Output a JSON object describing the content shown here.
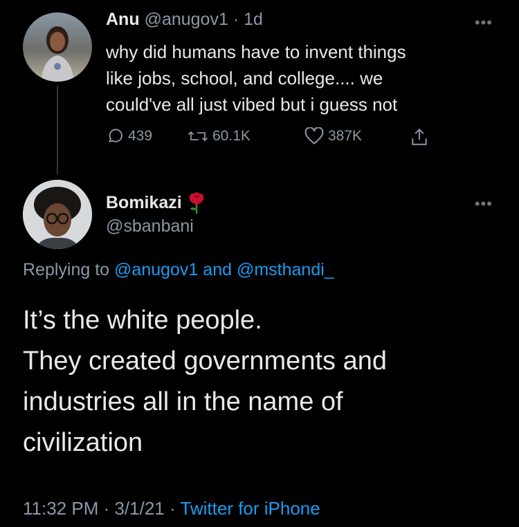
{
  "tweet": {
    "author_name": "Anu",
    "author_handle": "@anugov1",
    "separator": "·",
    "age": "1d",
    "text_lines": [
      "why did humans have to invent things",
      "like jobs, school, and college.... we",
      "could've all just vibed but i guess not"
    ],
    "stats": {
      "replies": "439",
      "retweets": "60.1K",
      "likes": "387K"
    }
  },
  "reply": {
    "author_name": "Bomikazi",
    "author_handle": "@sbanbani",
    "replying_prefix": "Replying to ",
    "replying_to_1": "@anugov1",
    "replying_and": " and ",
    "replying_to_2": "@msthandi_",
    "text_lines": [
      "It’s the white people.",
      "They created governments and",
      "industries all in the name of",
      "civilization"
    ],
    "time": "11:32 PM",
    "sep1": " · ",
    "date": "3/1/21",
    "sep2": " · ",
    "source": "Twitter for iPhone"
  },
  "colors": {
    "background": "#000000",
    "text": "#e7e9ea",
    "muted": "#8b98a5",
    "link": "#1d9bf0",
    "rose": "#c8102e"
  },
  "icons": {
    "more": "more-icon",
    "reply": "reply-icon",
    "retweet": "retweet-icon",
    "like": "heart-icon",
    "share": "share-icon",
    "emoji": "rose-emoji"
  }
}
